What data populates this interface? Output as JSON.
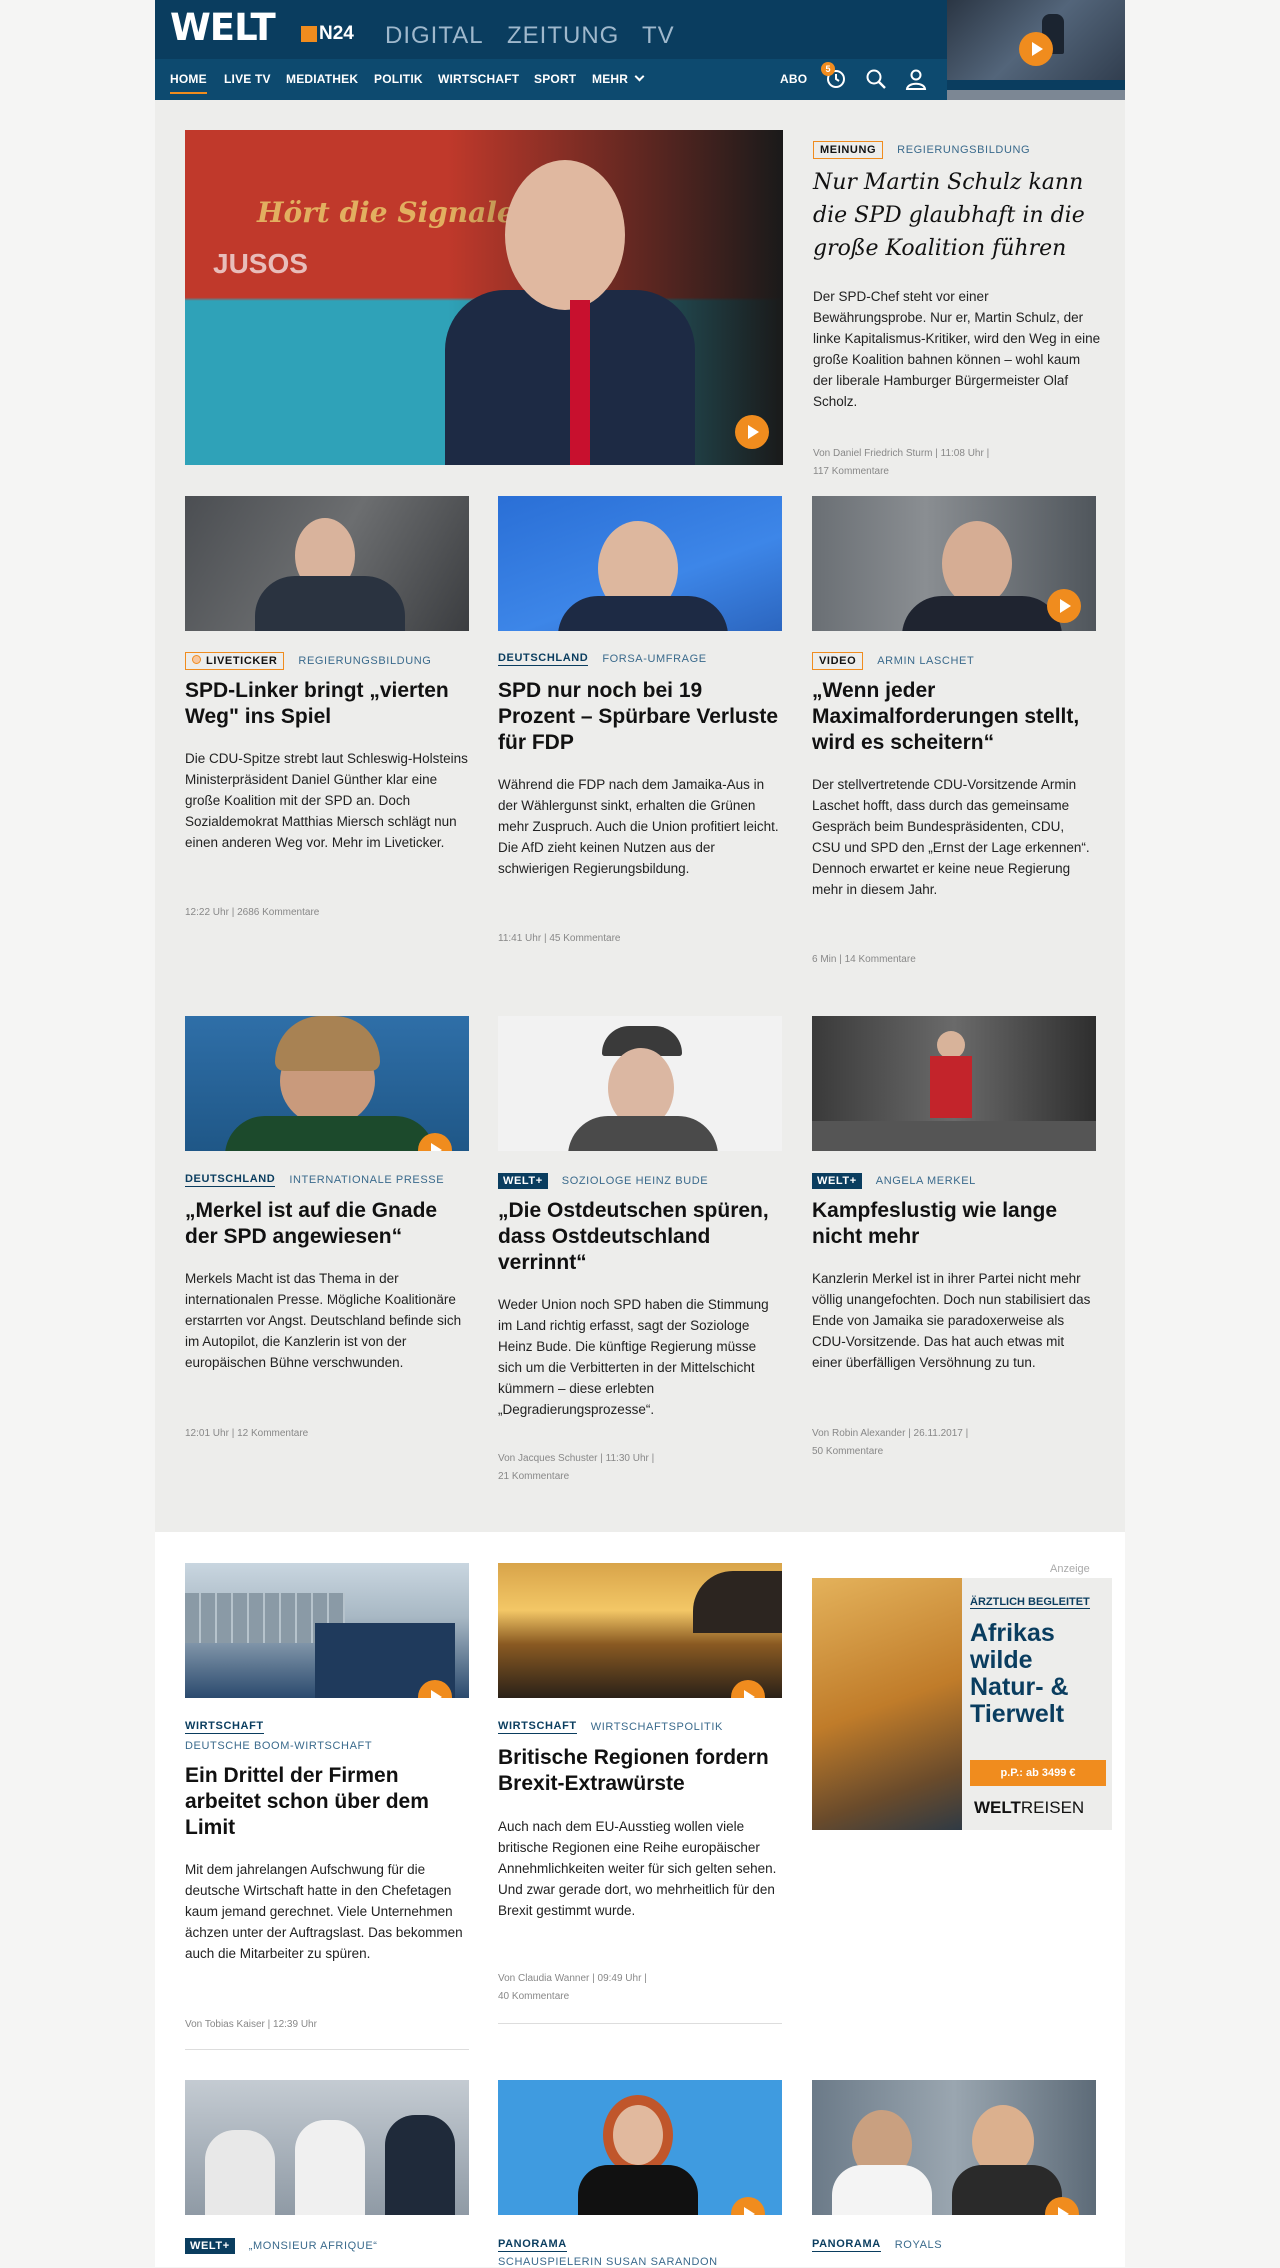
{
  "header": {
    "logo": "WELT",
    "n24": "N24",
    "top_links": [
      "DIGITAL",
      "ZEITUNG",
      "TV"
    ],
    "nav": [
      "HOME",
      "LIVE TV",
      "MEDIATHEK",
      "POLITIK",
      "WIRTSCHAFT",
      "SPORT",
      "MEHR"
    ],
    "abo": "ABO",
    "badge_count": "5"
  },
  "hero": {
    "kicker_box": "MEINUNG",
    "kicker_topic": "REGIERUNGSBILDUNG",
    "headline": "Nur Martin Schulz kann die SPD glaubhaft in die große Koalition führen",
    "teaser": "Der SPD-Chef steht vor einer Bewährungsprobe. Nur er, Martin Schulz, der linke Kapitalismus-Kritiker, wird den Weg in eine große Koalition bahnen können – wohl kaum der liberale Hamburger Bürgermeister Olaf Scholz.",
    "meta1": "Von Daniel Friedrich Sturm  |  11:08 Uhr  |",
    "meta2": "117 Kommentare",
    "image_text1": "Hört die Signale!",
    "image_text2": "JUSOS"
  },
  "row1": [
    {
      "k1": "LIVETICKER",
      "k2": "REGIERUNGSBILDUNG",
      "headline": "SPD-Linker bringt „vierten Weg\" ins Spiel",
      "teaser": "Die CDU-Spitze strebt laut Schleswig-Holsteins Ministerpräsident Daniel Günther klar eine große Koalition mit der SPD an. Doch Sozialdemokrat Matthias Miersch schlägt nun einen anderen Weg vor. Mehr im Liveticker.",
      "meta": "12:22 Uhr  |  2686 Kommentare"
    },
    {
      "k1": "DEUTSCHLAND",
      "k2": "FORSA-UMFRAGE",
      "headline": "SPD nur noch bei 19 Prozent – Spürbare Verluste für FDP",
      "teaser": "Während die FDP nach dem Jamaika-Aus in der Wählergunst sinkt, erhalten die Grünen mehr Zuspruch. Auch die Union profitiert leicht. Die AfD zieht keinen Nutzen aus der schwierigen Regierungsbildung.",
      "meta": "11:41 Uhr  |  45 Kommentare"
    },
    {
      "k1": "VIDEO",
      "k2": "ARMIN LASCHET",
      "headline": "„Wenn jeder Maximalforderungen stellt, wird es scheitern“",
      "teaser": "Der stellvertretende CDU-Vorsitzende Armin Laschet hofft, dass durch das gemeinsame Gespräch beim Bundespräsidenten, CDU, CSU und SPD den „Ernst der Lage erkennen“. Dennoch erwartet er keine neue Regierung mehr in diesem Jahr.",
      "meta": "6 Min  |  14 Kommentare"
    }
  ],
  "row2": [
    {
      "k1": "DEUTSCHLAND",
      "k2": "INTERNATIONALE PRESSE",
      "headline": "„Merkel ist auf die Gnade der SPD angewiesen“",
      "teaser": "Merkels Macht ist das Thema in der internationalen Presse. Mögliche Koalitionäre erstarrten vor Angst. Deutschland befinde sich im Autopilot, die Kanzlerin ist von der europäischen Bühne verschwunden.",
      "meta1": "12:01 Uhr  |  12 Kommentare",
      "meta2": ""
    },
    {
      "k1": "WELT+",
      "k2": "SOZIOLOGE HEINZ BUDE",
      "headline": "„Die Ostdeutschen spüren, dass Ostdeutschland verrinnt“",
      "teaser": "Weder Union noch SPD haben die Stimmung im Land richtig erfasst, sagt der Soziologe Heinz Bude. Die künftige Regierung müsse sich um die Verbitterten in der Mittelschicht kümmern – diese erlebten „Degradierungsprozesse“.",
      "meta1": "Von Jacques Schuster  |  11:30 Uhr  |",
      "meta2": "21 Kommentare"
    },
    {
      "k1": "WELT+",
      "k2": "ANGELA MERKEL",
      "headline": "Kampfeslustig wie lange nicht mehr",
      "teaser": "Kanzlerin Merkel ist in ihrer Partei nicht mehr völlig unangefochten. Doch nun stabilisiert das Ende von Jamaika sie paradoxerweise als CDU-Vorsitzende. Das hat auch etwas mit einer überfälligen Versöhnung zu tun.",
      "meta1": "Von Robin Alexander  |  26.11.2017  |",
      "meta2": "50 Kommentare"
    }
  ],
  "row3": [
    {
      "k1": "WIRTSCHAFT",
      "k2": "DEUTSCHE BOOM-WIRTSCHAFT",
      "headline": "Ein Drittel der Firmen arbeitet schon über dem Limit",
      "teaser": "Mit dem jahrelangen Aufschwung für die deutsche Wirtschaft hatte in den Chefetagen kaum jemand gerechnet. Viele Unternehmen ächzen unter der Auftragslast. Das bekommen auch die Mitarbeiter zu spüren.",
      "meta1": "Von Tobias Kaiser  |  12:39 Uhr",
      "meta2": ""
    },
    {
      "k1": "WIRTSCHAFT",
      "k2": "WIRTSCHAFTSPOLITIK",
      "headline": "Britische Regionen fordern Brexit-Extrawürste",
      "teaser": "Auch nach dem EU-Ausstieg wollen viele britische Regionen eine Reihe europäischer Annehmlichkeiten weiter für sich gelten sehen. Und zwar gerade dort, wo mehrheitlich für den Brexit gestimmt wurde.",
      "meta1": "Von Claudia Wanner  |  09:49 Uhr  |",
      "meta2": "40 Kommentare"
    }
  ],
  "ad": {
    "label": "Anzeige",
    "tag": "ÄRZTLICH BEGLEITET",
    "title": "Afrikas wilde Natur- & Tierwelt",
    "button": "p.P.: ab 3499 €",
    "brand_bold": "WELT",
    "brand_rest": "REISEN"
  },
  "row4": [
    {
      "k1": "WELT+",
      "k2": "„MONSIEUR AFRIQUE“"
    },
    {
      "k1": "PANORAMA",
      "k2": "SCHAUSPIELERIN SUSAN SARANDON"
    },
    {
      "k1": "PANORAMA",
      "k2": "ROYALS"
    }
  ],
  "colors": {
    "brand": "#0a3d5f",
    "accent": "#f08c1e"
  }
}
